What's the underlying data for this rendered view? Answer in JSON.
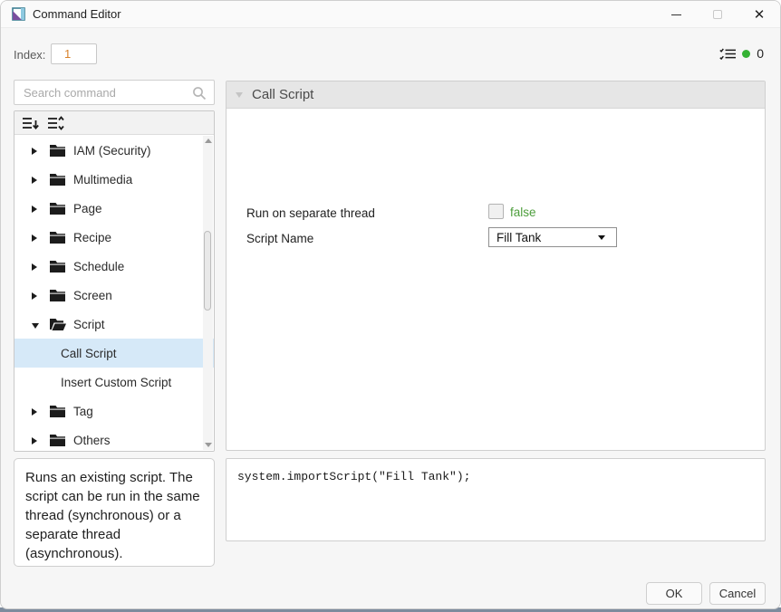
{
  "window": {
    "title": "Command Editor",
    "close_glyph": "✕"
  },
  "header": {
    "index_label": "Index:",
    "index_value": "1",
    "status_count": "0",
    "status_dot_color": "#35b234",
    "index_value_color": "#d9822b"
  },
  "sidebar": {
    "search_placeholder": "Search command",
    "tree": {
      "items": [
        {
          "label": "IAM (Security)",
          "type": "folder-collapsed"
        },
        {
          "label": "Multimedia",
          "type": "folder-collapsed"
        },
        {
          "label": "Page",
          "type": "folder-collapsed"
        },
        {
          "label": "Recipe",
          "type": "folder-collapsed"
        },
        {
          "label": "Schedule",
          "type": "folder-collapsed"
        },
        {
          "label": "Screen",
          "type": "folder-collapsed"
        },
        {
          "label": "Script",
          "type": "folder-open"
        },
        {
          "label": "Call Script",
          "type": "leaf",
          "selected": true
        },
        {
          "label": "Insert Custom Script",
          "type": "leaf"
        },
        {
          "label": "Tag",
          "type": "folder-collapsed"
        },
        {
          "label": "Others",
          "type": "folder-collapsed"
        }
      ],
      "selection_color": "#d6e9f8"
    },
    "description": "Runs an existing script. The script can be run in the same thread (synchronous) or a separate thread (asynchronous)."
  },
  "properties": {
    "header": "Call Script",
    "rows": [
      {
        "label": "Run on separate thread",
        "value": "false",
        "control": "checkbox",
        "checked": false,
        "value_color": "#4d9e3c"
      },
      {
        "label": "Script Name",
        "value": "Fill Tank",
        "control": "dropdown"
      }
    ]
  },
  "code": "system.importScript(\"Fill Tank\");",
  "footer": {
    "ok": "OK",
    "cancel": "Cancel"
  }
}
